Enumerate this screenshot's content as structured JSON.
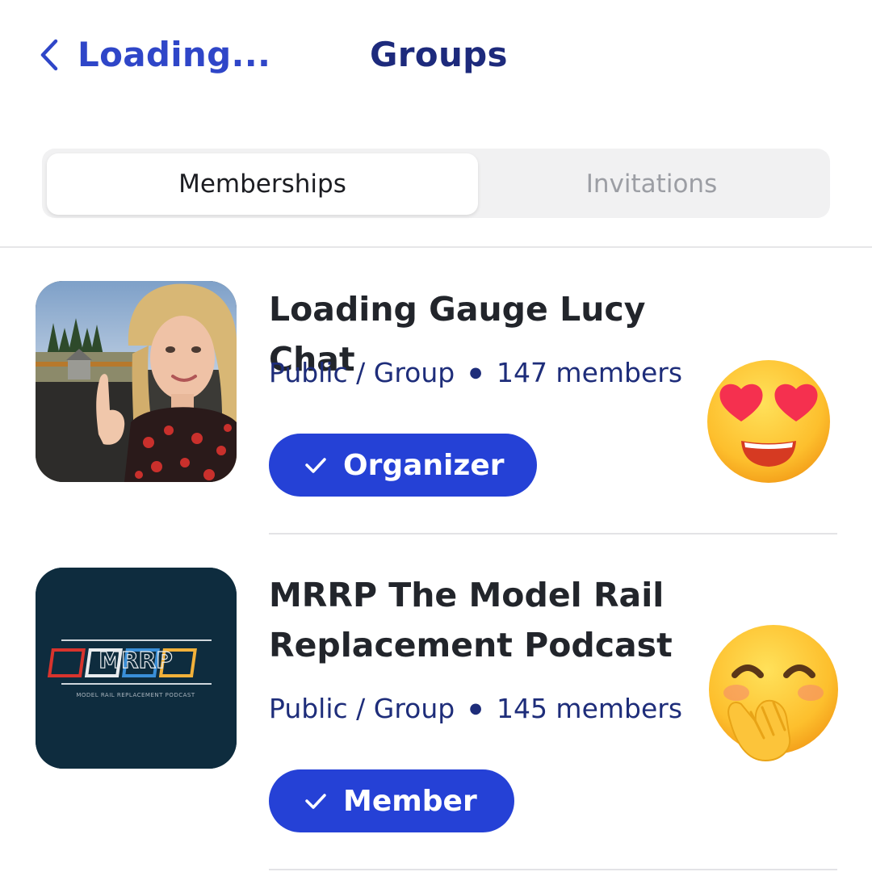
{
  "header": {
    "back_label": "Loading...",
    "title": "Groups"
  },
  "tabs": [
    {
      "label": "Memberships",
      "active": true
    },
    {
      "label": "Invitations",
      "active": false
    }
  ],
  "groups": [
    {
      "name": "Loading Gauge Lucy Chat",
      "privacy": "Public / Group",
      "members": "147 members",
      "role": "Organizer",
      "emoji": "heart-eyes-face"
    },
    {
      "name": "MRRP The Model Rail Replacement Podcast",
      "privacy": "Public / Group",
      "members": "145 members",
      "role": "Member",
      "emoji": "face-with-hand-over-mouth",
      "logo_text": "MRRP",
      "logo_subtext": "MODEL RAIL REPLACEMENT PODCAST"
    }
  ],
  "colors": {
    "accent": "#2541d6",
    "link": "#2f46c8",
    "title": "#1d2a7c",
    "meta": "#1e2d7a",
    "logo_background": "#0e2c3e"
  }
}
